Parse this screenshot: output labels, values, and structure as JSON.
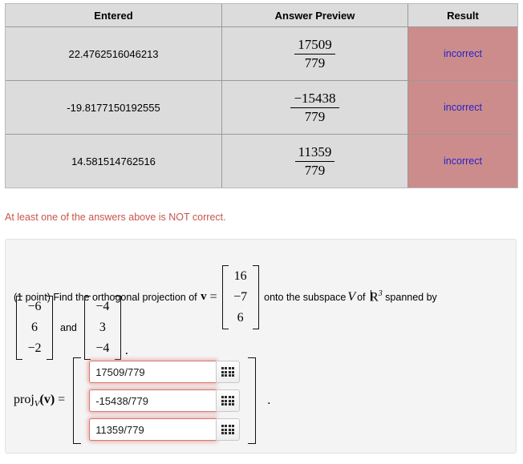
{
  "results_table": {
    "headers": [
      "Entered",
      "Answer Preview",
      "Result"
    ],
    "rows": [
      {
        "entered": "22.4762516046213",
        "preview": {
          "numerator": "17509",
          "denominator": "779"
        },
        "result": "incorrect"
      },
      {
        "entered": "-19.8177150192555",
        "preview": {
          "numerator": "−15438",
          "denominator": "779"
        },
        "result": "incorrect"
      },
      {
        "entered": "14.581514762516",
        "preview": {
          "numerator": "11359",
          "denominator": "779"
        },
        "result": "incorrect"
      }
    ],
    "colors": {
      "header_bg": "#dcdcdc",
      "cell_bg": "#dcdcdc",
      "result_bg": "#cd8c8c",
      "result_text": "#2323cc"
    }
  },
  "warning": {
    "text": "At least one of the answers above is NOT correct.",
    "color": "#c9544c"
  },
  "problem": {
    "points": "(1 point)",
    "intro": "Find the orthogonal projection of",
    "vector_symbol": "v",
    "equals": "=",
    "v_entries": [
      "16",
      "−7",
      "6"
    ],
    "middle": "onto the subspace",
    "subspace_symbol": "V",
    "of": "of",
    "field_symbol": "R",
    "field_exponent": "3",
    "spanned": "spanned by",
    "basis": [
      {
        "entries": [
          "−6",
          "6",
          "−2"
        ]
      },
      {
        "entries": [
          "−4",
          "3",
          "−4"
        ]
      }
    ],
    "and_word": "and",
    "period": ".",
    "answer": {
      "label_op": "proj",
      "label_sub": "V",
      "label_arg": "(v)",
      "label_equals": "=",
      "inputs": [
        {
          "value": "17509/779",
          "placeholder": ""
        },
        {
          "value": "-15438/779",
          "placeholder": ""
        },
        {
          "value": "11359/779",
          "placeholder": ""
        }
      ],
      "keypad_icon": "grid-keypad-icon",
      "trailing": "."
    }
  }
}
